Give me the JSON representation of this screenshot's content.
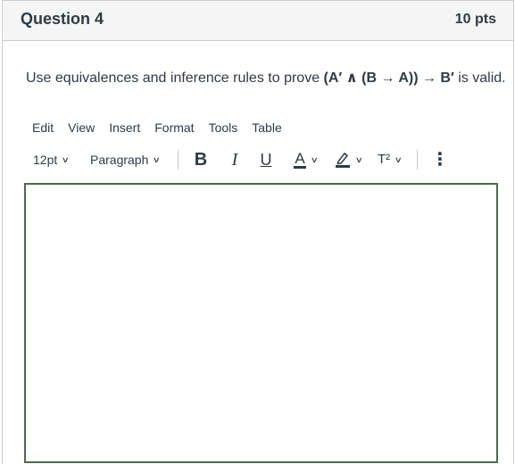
{
  "question": {
    "title": "Question 4",
    "points": "10 pts",
    "text_prefix": "Use equivalences and inference rules to prove ",
    "expression": "(A′ ∧ (B → A)) → B′",
    "text_suffix": " is valid."
  },
  "menubar": {
    "edit": "Edit",
    "view": "View",
    "insert": "Insert",
    "format": "Format",
    "tools": "Tools",
    "table": "Table"
  },
  "toolbar": {
    "font_size": "12pt",
    "block_format": "Paragraph",
    "bold": "B",
    "italic": "I",
    "underline": "U",
    "text_color": "A",
    "superscript": "T²",
    "more": "⋮"
  },
  "editor": {
    "content": ""
  }
}
